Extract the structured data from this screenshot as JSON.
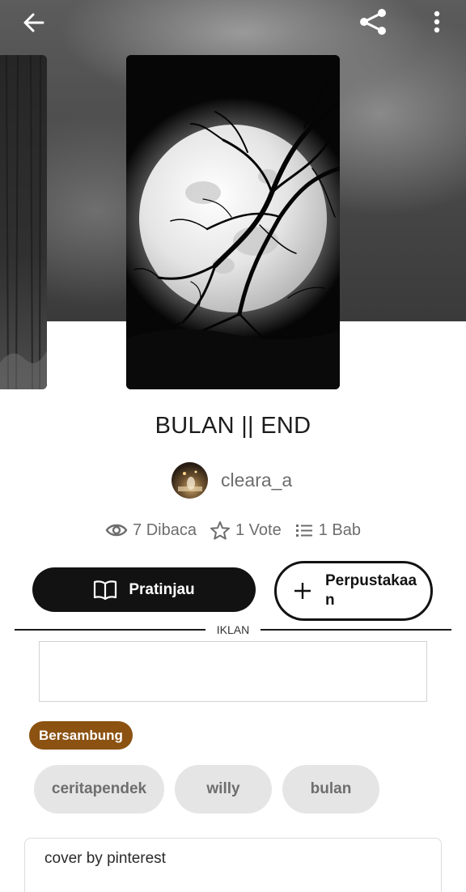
{
  "topbar": {
    "back_icon": "arrow-left-icon",
    "share_icon": "share-icon",
    "more_icon": "more-vertical-icon"
  },
  "story": {
    "title": "BULAN || END",
    "author": "cleara_a",
    "stats": {
      "reads": "7 Dibaca",
      "votes": "1 Vote",
      "parts": "1 Bab"
    }
  },
  "actions": {
    "preview_label": "Pratinjau",
    "library_label": "Perpustakaan"
  },
  "ad": {
    "label": "IKLAN"
  },
  "status_badge": "Bersambung",
  "tags": [
    "ceritapendek",
    "willy",
    "bulan"
  ],
  "description": "cover by pinterest",
  "colors": {
    "primary": "#121212",
    "badge": "#8b5212",
    "tag_bg": "#e5e5e5",
    "muted_text": "#6d6d6d"
  }
}
